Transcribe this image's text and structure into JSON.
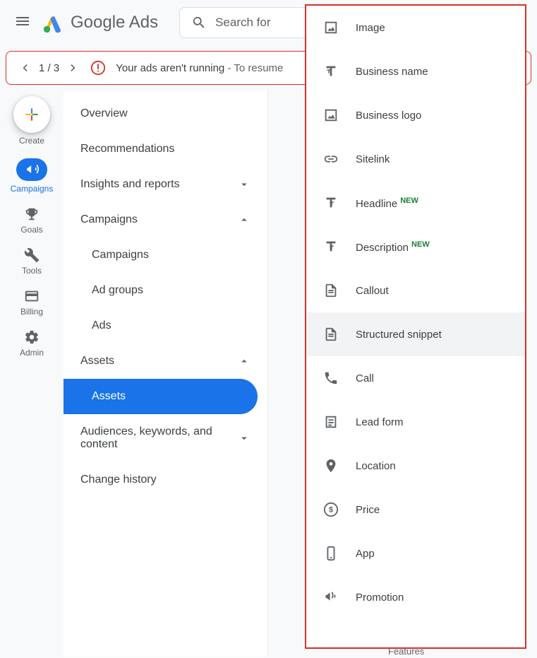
{
  "header": {
    "logo_text": "Google Ads",
    "search_placeholder": "Search for"
  },
  "alert": {
    "counter": "1 / 3",
    "bold": "Your ads aren't running",
    "light": " - To resume"
  },
  "left_rail": {
    "create": "Create",
    "campaigns": "Campaigns",
    "goals": "Goals",
    "tools": "Tools",
    "billing": "Billing",
    "admin": "Admin"
  },
  "side_nav": {
    "overview": "Overview",
    "recommendations": "Recommendations",
    "insights": "Insights and reports",
    "campaigns": "Campaigns",
    "campaigns_sub": "Campaigns",
    "ad_groups": "Ad groups",
    "ads": "Ads",
    "assets": "Assets",
    "assets_sub": "Assets",
    "audiences": "Audiences, keywords, and content",
    "history": "Change history"
  },
  "menu": {
    "image": "Image",
    "business_name": "Business name",
    "business_logo": "Business logo",
    "sitelink": "Sitelink",
    "headline": "Headline",
    "description": "Description",
    "new_badge": "NEW",
    "callout": "Callout",
    "structured": "Structured snippet",
    "call": "Call",
    "lead_form": "Lead form",
    "location": "Location",
    "price": "Price",
    "app": "App",
    "promotion": "Promotion"
  },
  "footer": {
    "features": "Features"
  }
}
